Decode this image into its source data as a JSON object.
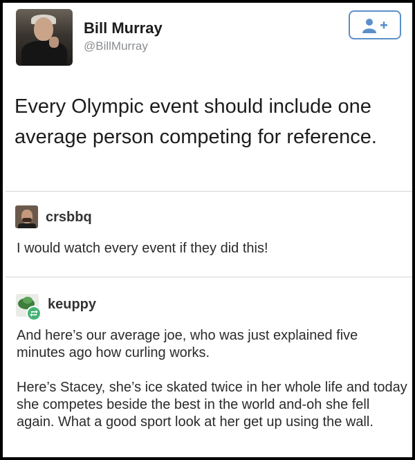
{
  "tweet": {
    "display_name": "Bill Murray",
    "handle": "@BillMurray",
    "follow_icon": "add-user-icon",
    "text": "Every Olympic event should include one average person competing for reference."
  },
  "replies": [
    {
      "username": "crsbbq",
      "avatar": "man-with-mustache-avatar",
      "text": "I would watch every event if they did this!"
    },
    {
      "username": "keuppy",
      "avatar": "green-creature-avatar",
      "badge_icon": "reblog-icon",
      "paragraphs": [
        "And here’s our average joe, who was just explained five minutes ago how curling works.",
        "Here’s Stacey, she’s ice skated twice in her whole life and today she competes beside the best in the world and-oh she fell again. What a good sport look at her get up using the wall."
      ]
    }
  ],
  "colors": {
    "follow_border": "#5b8fc9",
    "reblog_badge": "#46b374",
    "frame": "#000000",
    "divider": "#d5d5d5"
  }
}
